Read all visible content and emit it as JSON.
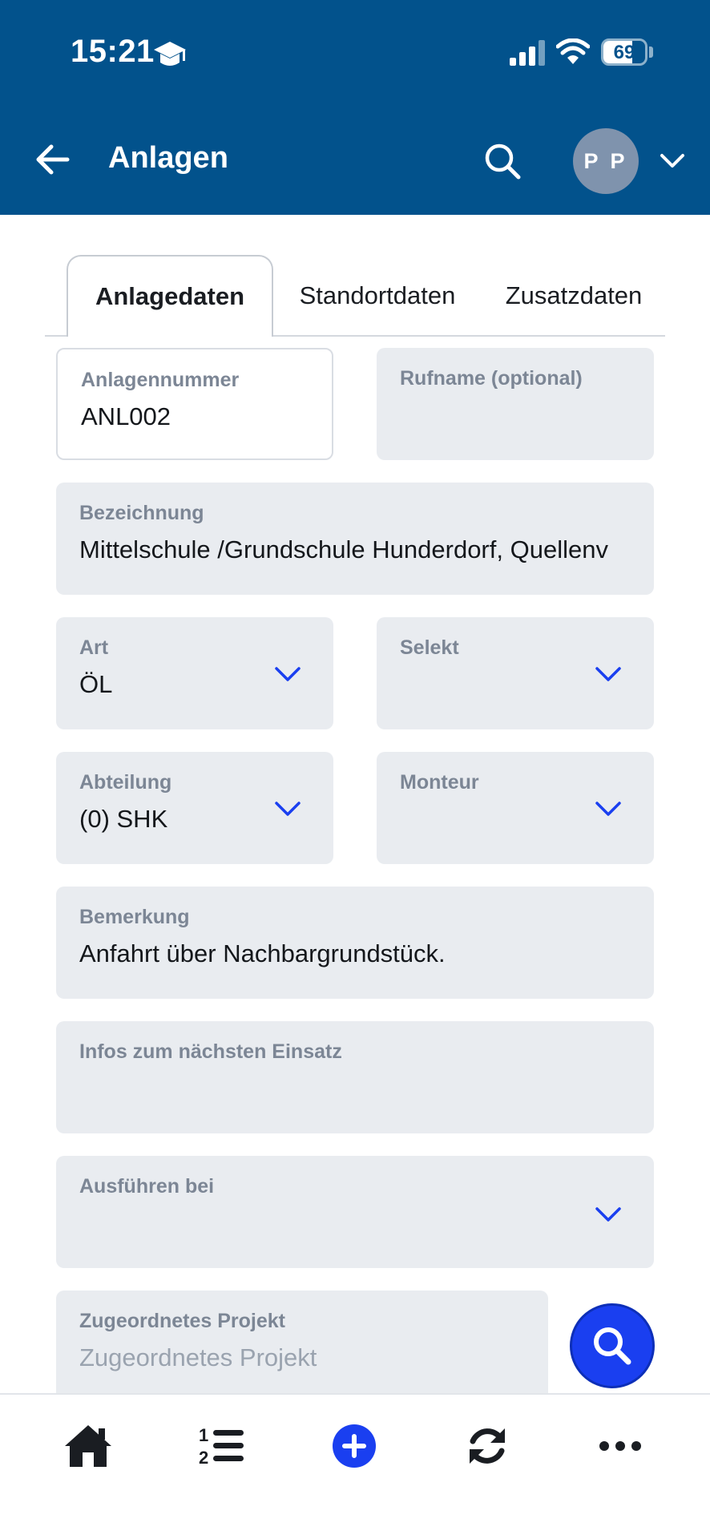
{
  "status_bar": {
    "time": "15:21",
    "battery": "69",
    "battery_level": 0.69
  },
  "header": {
    "title": "Anlagen",
    "avatar_initials": "P P"
  },
  "tabs": [
    {
      "label": "Anlagedaten",
      "active": true
    },
    {
      "label": "Standortdaten",
      "active": false
    },
    {
      "label": "Zusatzdaten",
      "active": false
    }
  ],
  "fields": {
    "anlagennummer": {
      "label": "Anlagennummer",
      "value": "ANL002"
    },
    "rufname": {
      "label": "Rufname (optional)",
      "value": ""
    },
    "bezeichnung": {
      "label": "Bezeichnung",
      "value": "Mittelschule /Grundschule Hunderdorf, Quellenv"
    },
    "art": {
      "label": "Art",
      "value": "ÖL"
    },
    "selekt": {
      "label": "Selekt",
      "value": ""
    },
    "abteilung": {
      "label": "Abteilung",
      "value": "(0) SHK"
    },
    "monteur": {
      "label": "Monteur",
      "value": ""
    },
    "bemerkung": {
      "label": "Bemerkung",
      "value": "Anfahrt über Nachbargrundstück."
    },
    "infos": {
      "label": "Infos zum nächsten Einsatz",
      "value": ""
    },
    "ausfuehren": {
      "label": "Ausführen bei",
      "value": ""
    },
    "projekt": {
      "label": "Zugeordnetes Projekt",
      "placeholder": "Zugeordnetes Projekt"
    }
  },
  "colors": {
    "header": "#02528c",
    "accent": "#1a3ff0",
    "field_bg": "#e9ecf0"
  },
  "bottom_nav": [
    "home-icon",
    "numbered-list-icon",
    "add-icon",
    "sync-icon",
    "more-icon"
  ]
}
